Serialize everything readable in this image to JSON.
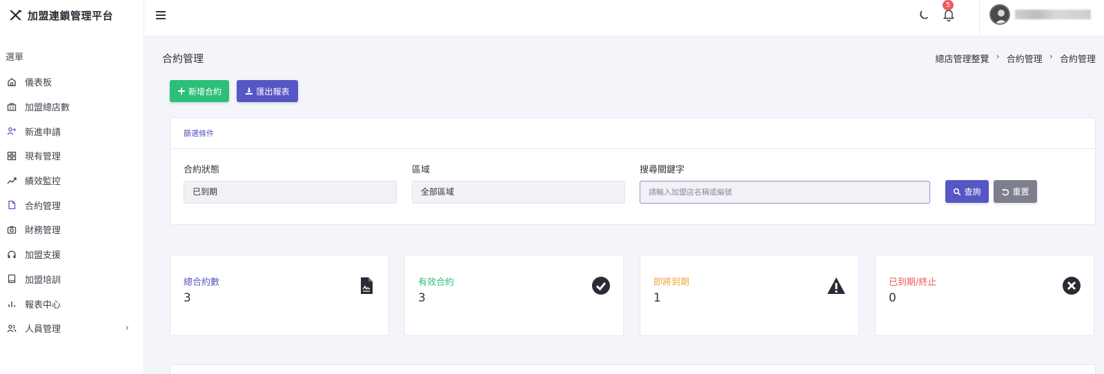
{
  "app": {
    "title": "加盟連鎖管理平台"
  },
  "sidebar": {
    "heading": "選單",
    "items": [
      {
        "label": "儀表板",
        "icon": "home-icon"
      },
      {
        "label": "加盟總店數",
        "icon": "building-icon"
      },
      {
        "label": "新進申請",
        "icon": "user-plus-icon"
      },
      {
        "label": "現有管理",
        "icon": "grid-icon"
      },
      {
        "label": "績效監控",
        "icon": "trending-icon"
      },
      {
        "label": "合約管理",
        "icon": "file-icon"
      },
      {
        "label": "財務管理",
        "icon": "camera-icon"
      },
      {
        "label": "加盟支援",
        "icon": "headphones-icon"
      },
      {
        "label": "加盟培訓",
        "icon": "book-icon"
      },
      {
        "label": "報表中心",
        "icon": "bar-chart-icon"
      },
      {
        "label": "人員管理",
        "icon": "users-icon",
        "chevron": "›"
      }
    ]
  },
  "topbar": {
    "notification_count": "5"
  },
  "page": {
    "title": "合約管理",
    "breadcrumb": [
      "總店管理整覽",
      "合約管理",
      "合約管理"
    ],
    "breadcrumb_sep": "›"
  },
  "actions": {
    "add_label": "新增合約",
    "export_label": "匯出報表"
  },
  "filter": {
    "title": "篩選條件",
    "status_label": "合約狀態",
    "status_value": "已到期",
    "region_label": "區域",
    "region_value": "全部區域",
    "keyword_label": "搜尋關鍵字",
    "keyword_placeholder": "請輸入加盟店名稱或編號",
    "search_label": "查詢",
    "reset_label": "重置"
  },
  "stats": [
    {
      "label": "總合約數",
      "value": "3",
      "color": "#5657c4",
      "icon": "contract-icon"
    },
    {
      "label": "有效合約",
      "value": "3",
      "color": "#2dbf7a",
      "icon": "check-circle-icon"
    },
    {
      "label": "即將到期",
      "value": "1",
      "color": "#f0a53a",
      "icon": "warning-icon"
    },
    {
      "label": "已到期/終止",
      "value": "0",
      "color": "#ef5a5a",
      "icon": "x-circle-icon"
    }
  ],
  "colors": {
    "primary": "#5657c4",
    "success": "#2dbf7a",
    "secondary": "#7e7f8c"
  }
}
